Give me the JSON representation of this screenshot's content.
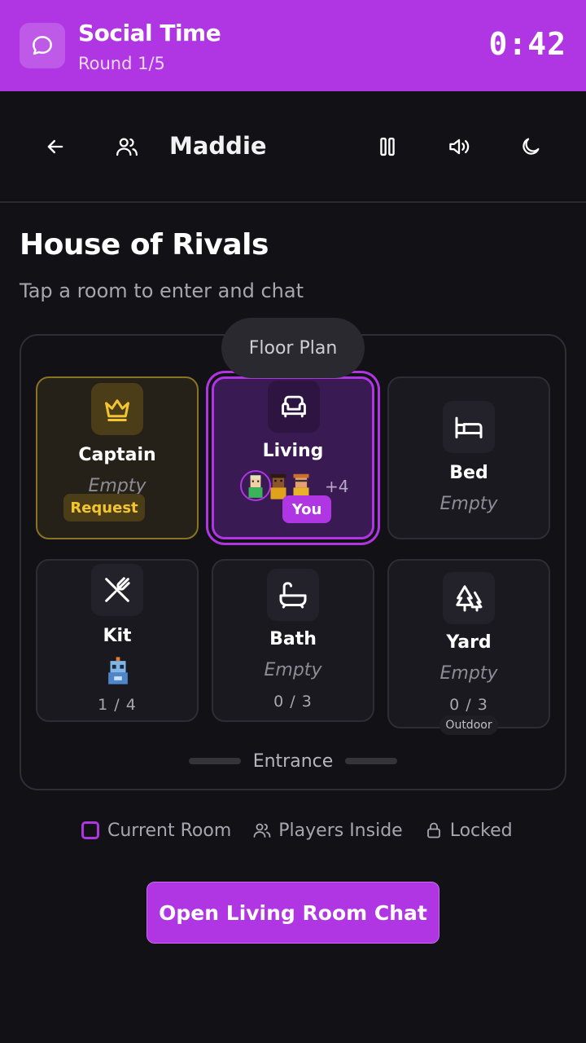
{
  "banner": {
    "title": "Social Time",
    "round": "Round 1/5",
    "timer": "0:42",
    "icon": "chat-bubble-icon"
  },
  "toolbar": {
    "back_icon": "arrow-left-icon",
    "players_icon": "users-icon",
    "player_name": "Maddie",
    "pause_icon": "pause-icon",
    "sound_icon": "volume-icon",
    "theme_icon": "moon-icon"
  },
  "page": {
    "title": "House of Rivals",
    "subtitle": "Tap a room to enter and chat"
  },
  "floor_plan": {
    "label": "Floor Plan",
    "entrance": "Entrance",
    "rooms": [
      {
        "name": "Captain",
        "status": "Empty",
        "badge": "Request",
        "icon": "crown-icon",
        "accent": "#f5c531"
      },
      {
        "name": "Living",
        "extra_count": "+4",
        "badge": "You",
        "icon": "sofa-icon",
        "current": true
      },
      {
        "name": "Bed",
        "status": "Empty",
        "icon": "bed-icon"
      },
      {
        "name": "Kit",
        "occupancy": "1 / 4",
        "icon": "utensils-icon"
      },
      {
        "name": "Bath",
        "status": "Empty",
        "occupancy": "0 / 3",
        "icon": "bathtub-icon"
      },
      {
        "name": "Yard",
        "status": "Empty",
        "occupancy": "0 / 3",
        "tag": "Outdoor",
        "icon": "trees-icon"
      }
    ]
  },
  "legend": {
    "current": "Current Room",
    "players": "Players Inside",
    "locked": "Locked"
  },
  "action": {
    "label": "Open Living Room Chat"
  },
  "colors": {
    "accent": "#b035e3",
    "gold": "#f5c531",
    "background": "#121116"
  }
}
